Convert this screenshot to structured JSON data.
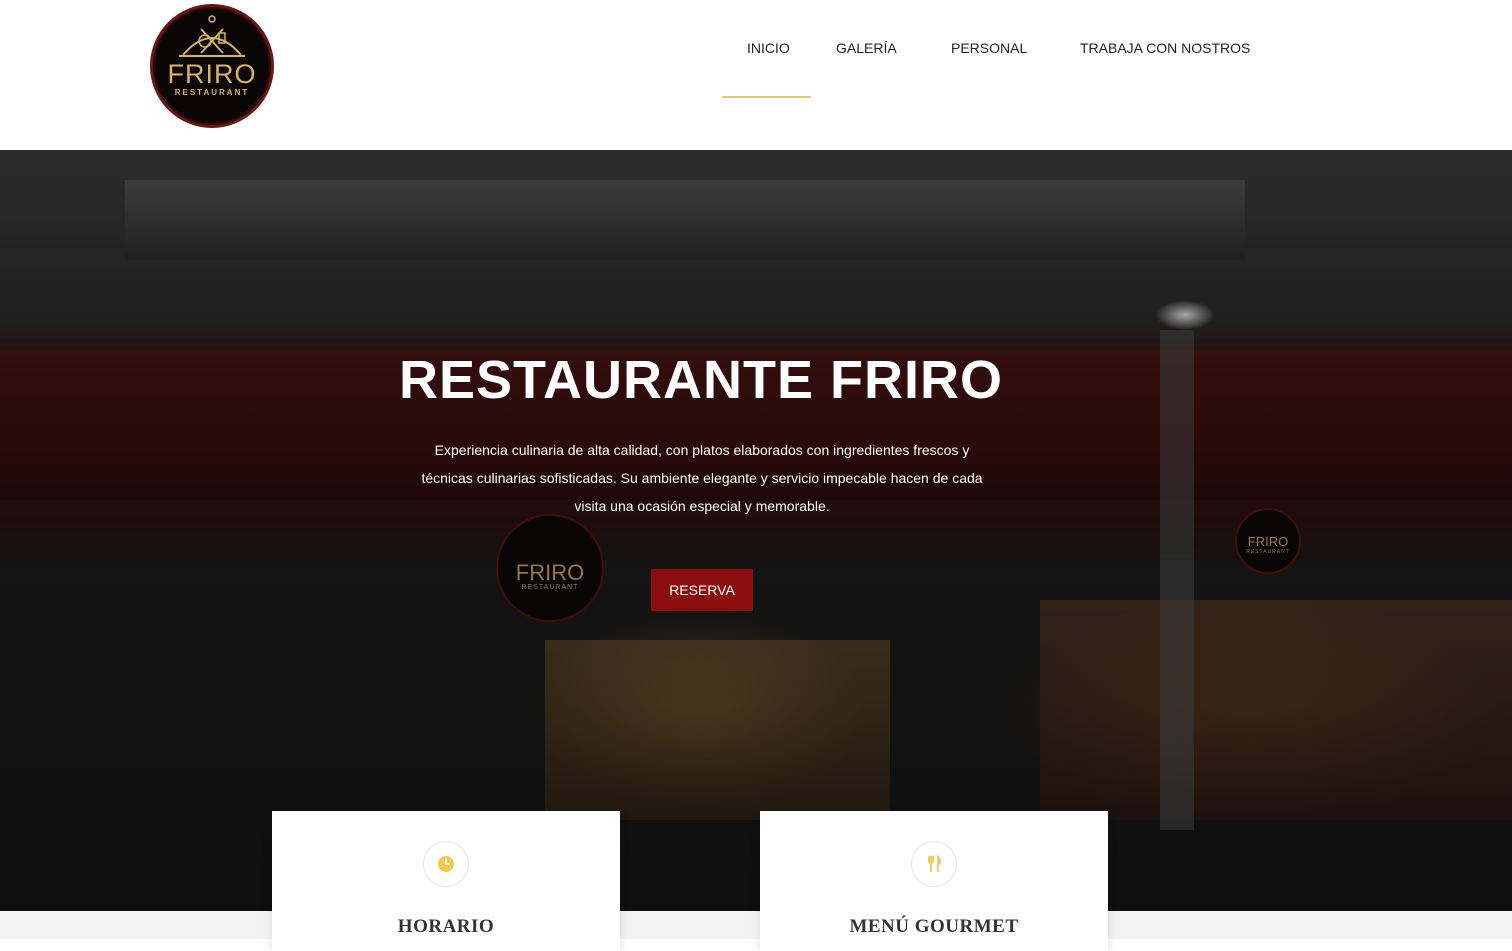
{
  "header": {
    "logo": {
      "name": "FRIRO",
      "subtitle": "RESTAURANT"
    },
    "nav": [
      {
        "label": "INICIO",
        "active": true
      },
      {
        "label": "GALERÍA",
        "active": false
      },
      {
        "label": "PERSONAL",
        "active": false
      },
      {
        "label": "TRABAJA CON NOSTROS",
        "active": false
      }
    ],
    "accent_color": "#e8c76a"
  },
  "hero": {
    "title": "RESTAURANTE FRIRO",
    "description": "Experiencia culinaria de alta calidad, con platos elaborados con ingredientes frescos y técnicas culinarias sofisticadas. Su ambiente elegante y servicio impecable hacen de cada visita una ocasión especial y memorable.",
    "button_label": "RESERVA",
    "button_color": "#8b0d0d",
    "sign_left": {
      "name": "FRIRO",
      "subtitle": "RESTAURANT"
    },
    "sign_right": {
      "name": "FRIRO",
      "subtitle": "RESTAURANT"
    }
  },
  "cards": [
    {
      "title": "HORARIO",
      "icon": "clock-icon"
    },
    {
      "title": "MENÚ GOURMET",
      "icon": "cutlery-icon"
    }
  ]
}
